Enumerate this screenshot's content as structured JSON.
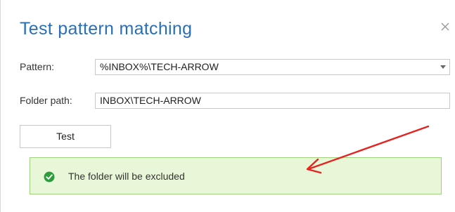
{
  "dialog": {
    "title": "Test pattern matching",
    "close_icon": "close-icon"
  },
  "form": {
    "pattern_label": "Pattern:",
    "pattern_value": "%INBOX%\\TECH-ARROW",
    "folder_label": "Folder path:",
    "folder_value": "INBOX\\TECH-ARROW"
  },
  "actions": {
    "test_label": "Test"
  },
  "result": {
    "icon": "check-circle-icon",
    "message": "The folder will be excluded",
    "status_color": "#2e9c3c"
  },
  "annotation": {
    "icon": "red-arrow-icon",
    "color": "#e52421"
  }
}
